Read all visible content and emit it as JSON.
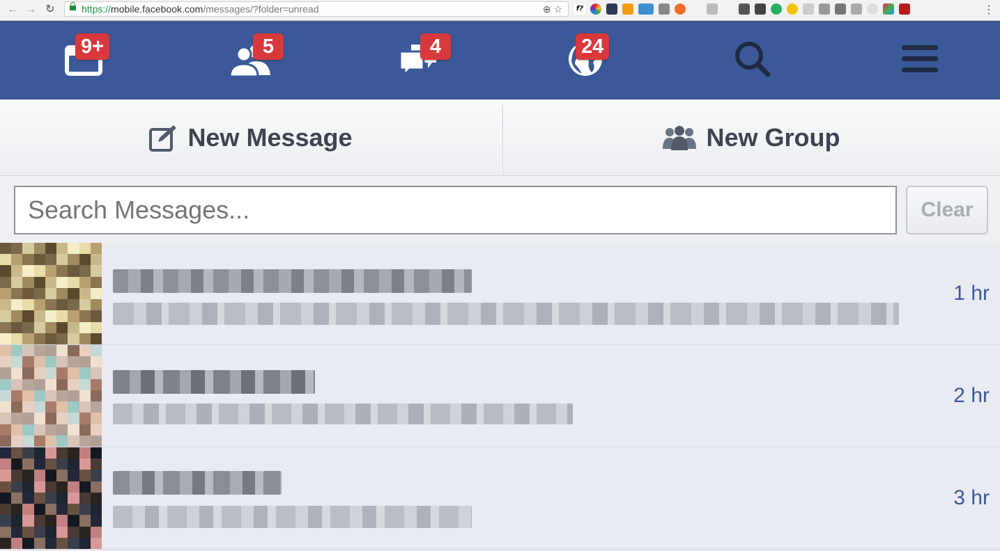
{
  "browser": {
    "url_scheme": "https://",
    "url_host": "mobile.facebook.com",
    "url_path": "/messages/?folder=unread"
  },
  "topbar": {
    "tabs": [
      {
        "name": "notifications-calendar-icon",
        "badge": "9+"
      },
      {
        "name": "friend-requests-icon",
        "badge": "5"
      },
      {
        "name": "messages-icon",
        "badge": "4"
      },
      {
        "name": "notifications-globe-icon",
        "badge": "24"
      },
      {
        "name": "search-icon",
        "badge": ""
      },
      {
        "name": "menu-icon",
        "badge": ""
      }
    ]
  },
  "actions": {
    "new_message_label": "New Message",
    "new_group_label": "New Group"
  },
  "search": {
    "placeholder": "Search Messages...",
    "clear_label": "Clear"
  },
  "threads": [
    {
      "time": "1 hr"
    },
    {
      "time": "2 hr"
    },
    {
      "time": "3 hr"
    }
  ],
  "colors": {
    "brand": "#3b5998",
    "badge": "#d9393c",
    "timestamp": "#3b5998"
  }
}
